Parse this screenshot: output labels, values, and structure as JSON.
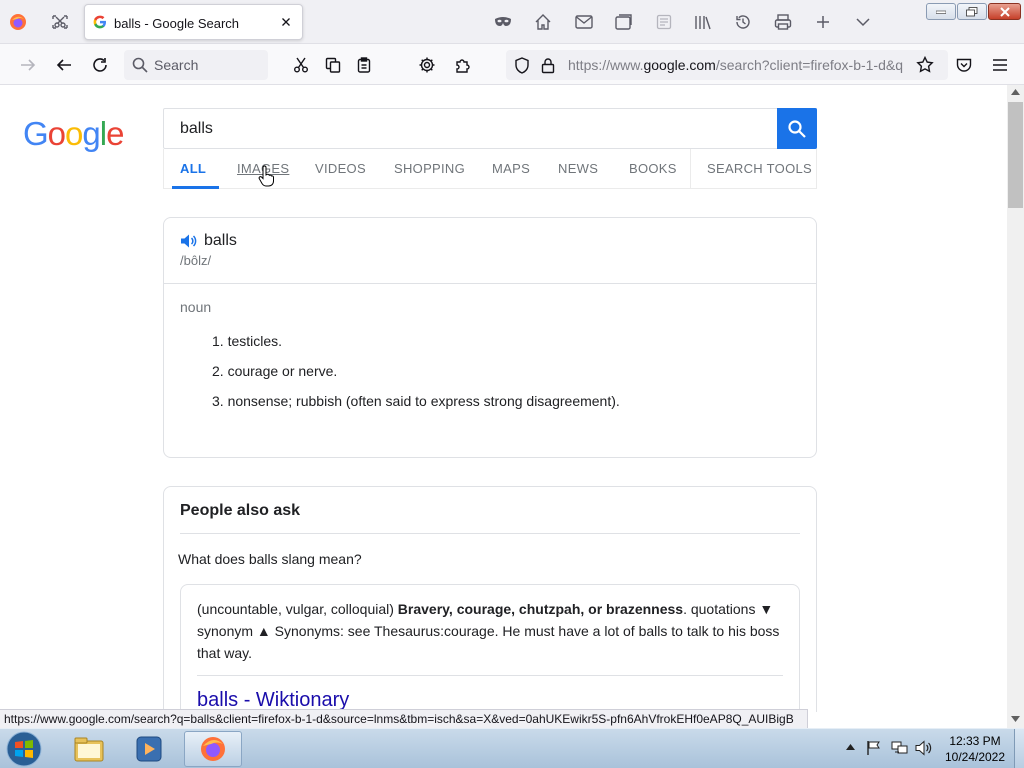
{
  "browser": {
    "tab_title": "balls - Google Search",
    "toolbar_search_label": "Search",
    "url_prefix": "https://www.",
    "url_domain": "google.com",
    "url_rest": "/search?client=firefox-b-1-d&q",
    "status_link": "https://www.google.com/search?q=balls&client=firefox-b-1-d&source=lnms&tbm=isch&sa=X&ved=0ahUKEwikr5S-pfn6AhVfrokEHf0eAP8Q_AUIBigB"
  },
  "google": {
    "logo": [
      "G",
      "o",
      "o",
      "g",
      "l",
      "e"
    ],
    "logo_colors": [
      "#4285f4",
      "#ea4335",
      "#fbbc05",
      "#4285f4",
      "#34a853",
      "#ea4335"
    ],
    "query": "balls",
    "tabs": {
      "all": "ALL",
      "images": "IMAGES",
      "videos": "VIDEOS",
      "shopping": "SHOPPING",
      "maps": "MAPS",
      "news": "NEWS",
      "books": "BOOKS",
      "search_tools": "SEARCH TOOLS"
    },
    "dictionary": {
      "word": "balls",
      "phonetic": "/bôlz/",
      "part_of_speech": "noun",
      "definitions": [
        "1. testicles.",
        "2. courage or nerve.",
        "3. nonsense; rubbish (often said to express strong disagreement)."
      ]
    },
    "people_also_ask": {
      "title": "People also ask",
      "question": "What does balls slang mean?",
      "answer_prefix": "(uncountable, vulgar, colloquial) ",
      "answer_bold": "Bravery, courage, chutzpah, or brazenness",
      "answer_suffix": ". quotations ▼ synonym ▲ Synonyms: see Thesaurus:courage. He must have a lot of balls to talk to his boss that way.",
      "link_text": "balls - Wiktionary"
    }
  },
  "taskbar": {
    "time": "12:33 PM",
    "date": "10/24/2022"
  },
  "colors": {
    "accent": "#1a73e8",
    "link": "#1a0dab"
  }
}
